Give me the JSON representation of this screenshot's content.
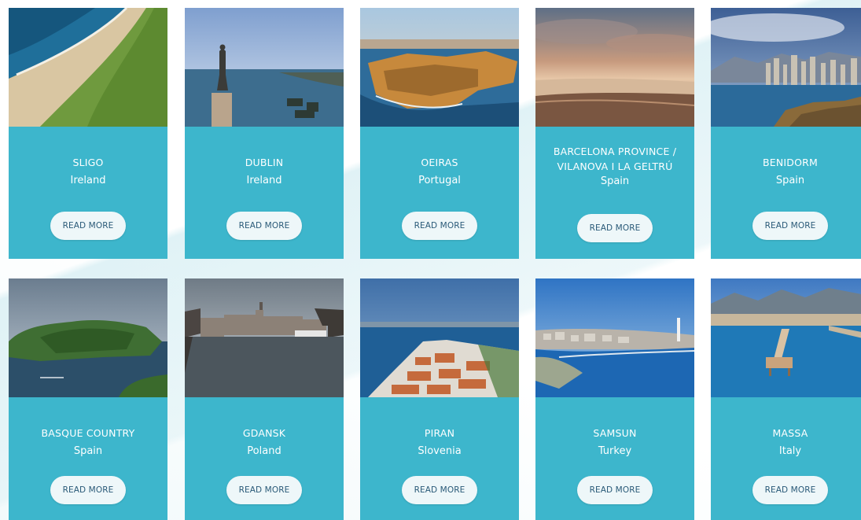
{
  "destinations": [
    {
      "city": "SLIGO",
      "country": "Ireland",
      "button": "READ MORE"
    },
    {
      "city": "DUBLIN",
      "country": "Ireland",
      "button": "READ MORE"
    },
    {
      "city": "OEIRAS",
      "country": "Portugal",
      "button": "READ MORE"
    },
    {
      "city": "BARCELONA PROVINCE / VILANOVA I LA GELTRÚ",
      "country": "Spain",
      "button": "READ MORE"
    },
    {
      "city": "BENIDORM",
      "country": "Spain",
      "button": "READ MORE"
    },
    {
      "city": "BASQUE COUNTRY",
      "country": "Spain",
      "button": "READ MORE"
    },
    {
      "city": "GDANSK",
      "country": "Poland",
      "button": "READ MORE"
    },
    {
      "city": "PIRAN",
      "country": "Slovenia",
      "button": "READ MORE"
    },
    {
      "city": "SAMSUN",
      "country": "Turkey",
      "button": "READ MORE"
    },
    {
      "city": "MASSA",
      "country": "Italy",
      "button": "READ MORE"
    }
  ],
  "colors": {
    "card": "#3db6cc",
    "button": "#eef7f9",
    "button_text": "#2a5a78"
  }
}
